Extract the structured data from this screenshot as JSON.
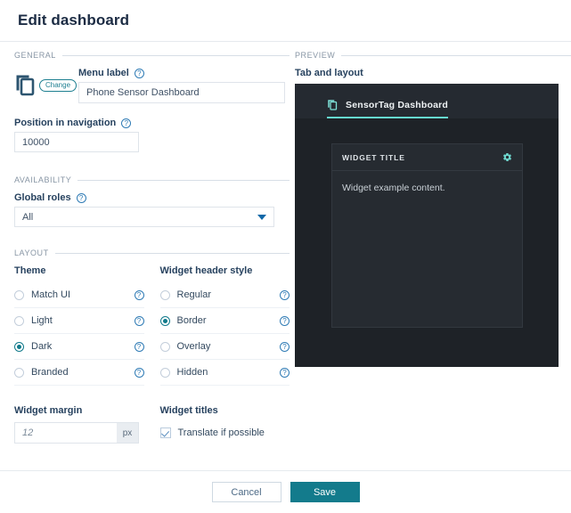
{
  "header": {
    "title": "Edit dashboard"
  },
  "general": {
    "legend": "GENERAL",
    "app_icon": "copy-icon",
    "change_label": "Change",
    "menu_label": "Menu label",
    "menu_value": "Phone Sensor Dashboard",
    "position_label": "Position in navigation",
    "position_value": "10000"
  },
  "availability": {
    "legend": "AVAILABILITY",
    "roles_label": "Global roles",
    "roles_value": "All"
  },
  "layout": {
    "legend": "LAYOUT",
    "theme_label": "Theme",
    "theme_options": [
      {
        "label": "Match UI",
        "selected": false
      },
      {
        "label": "Light",
        "selected": false
      },
      {
        "label": "Dark",
        "selected": true
      },
      {
        "label": "Branded",
        "selected": false
      }
    ],
    "header_style_label": "Widget header style",
    "header_style_options": [
      {
        "label": "Regular",
        "selected": false
      },
      {
        "label": "Border",
        "selected": true
      },
      {
        "label": "Overlay",
        "selected": false
      },
      {
        "label": "Hidden",
        "selected": false
      }
    ],
    "margin_label": "Widget margin",
    "margin_value": "12",
    "margin_unit": "px",
    "titles_label": "Widget titles",
    "translate_label": "Translate if possible",
    "translate_checked": true
  },
  "preview": {
    "legend": "PREVIEW",
    "caption": "Tab and layout",
    "tab_label": "SensorTag Dashboard",
    "widget_title": "WIDGET TITLE",
    "widget_content": "Widget example content.",
    "gear_icon": "gear-icon"
  },
  "footer": {
    "cancel_label": "Cancel",
    "save_label": "Save"
  },
  "colors": {
    "accent_teal": "#137b8c",
    "preview_bg": "#1e2227",
    "tab_underline": "#66d9d0",
    "help_blue": "#2f7bb5"
  }
}
